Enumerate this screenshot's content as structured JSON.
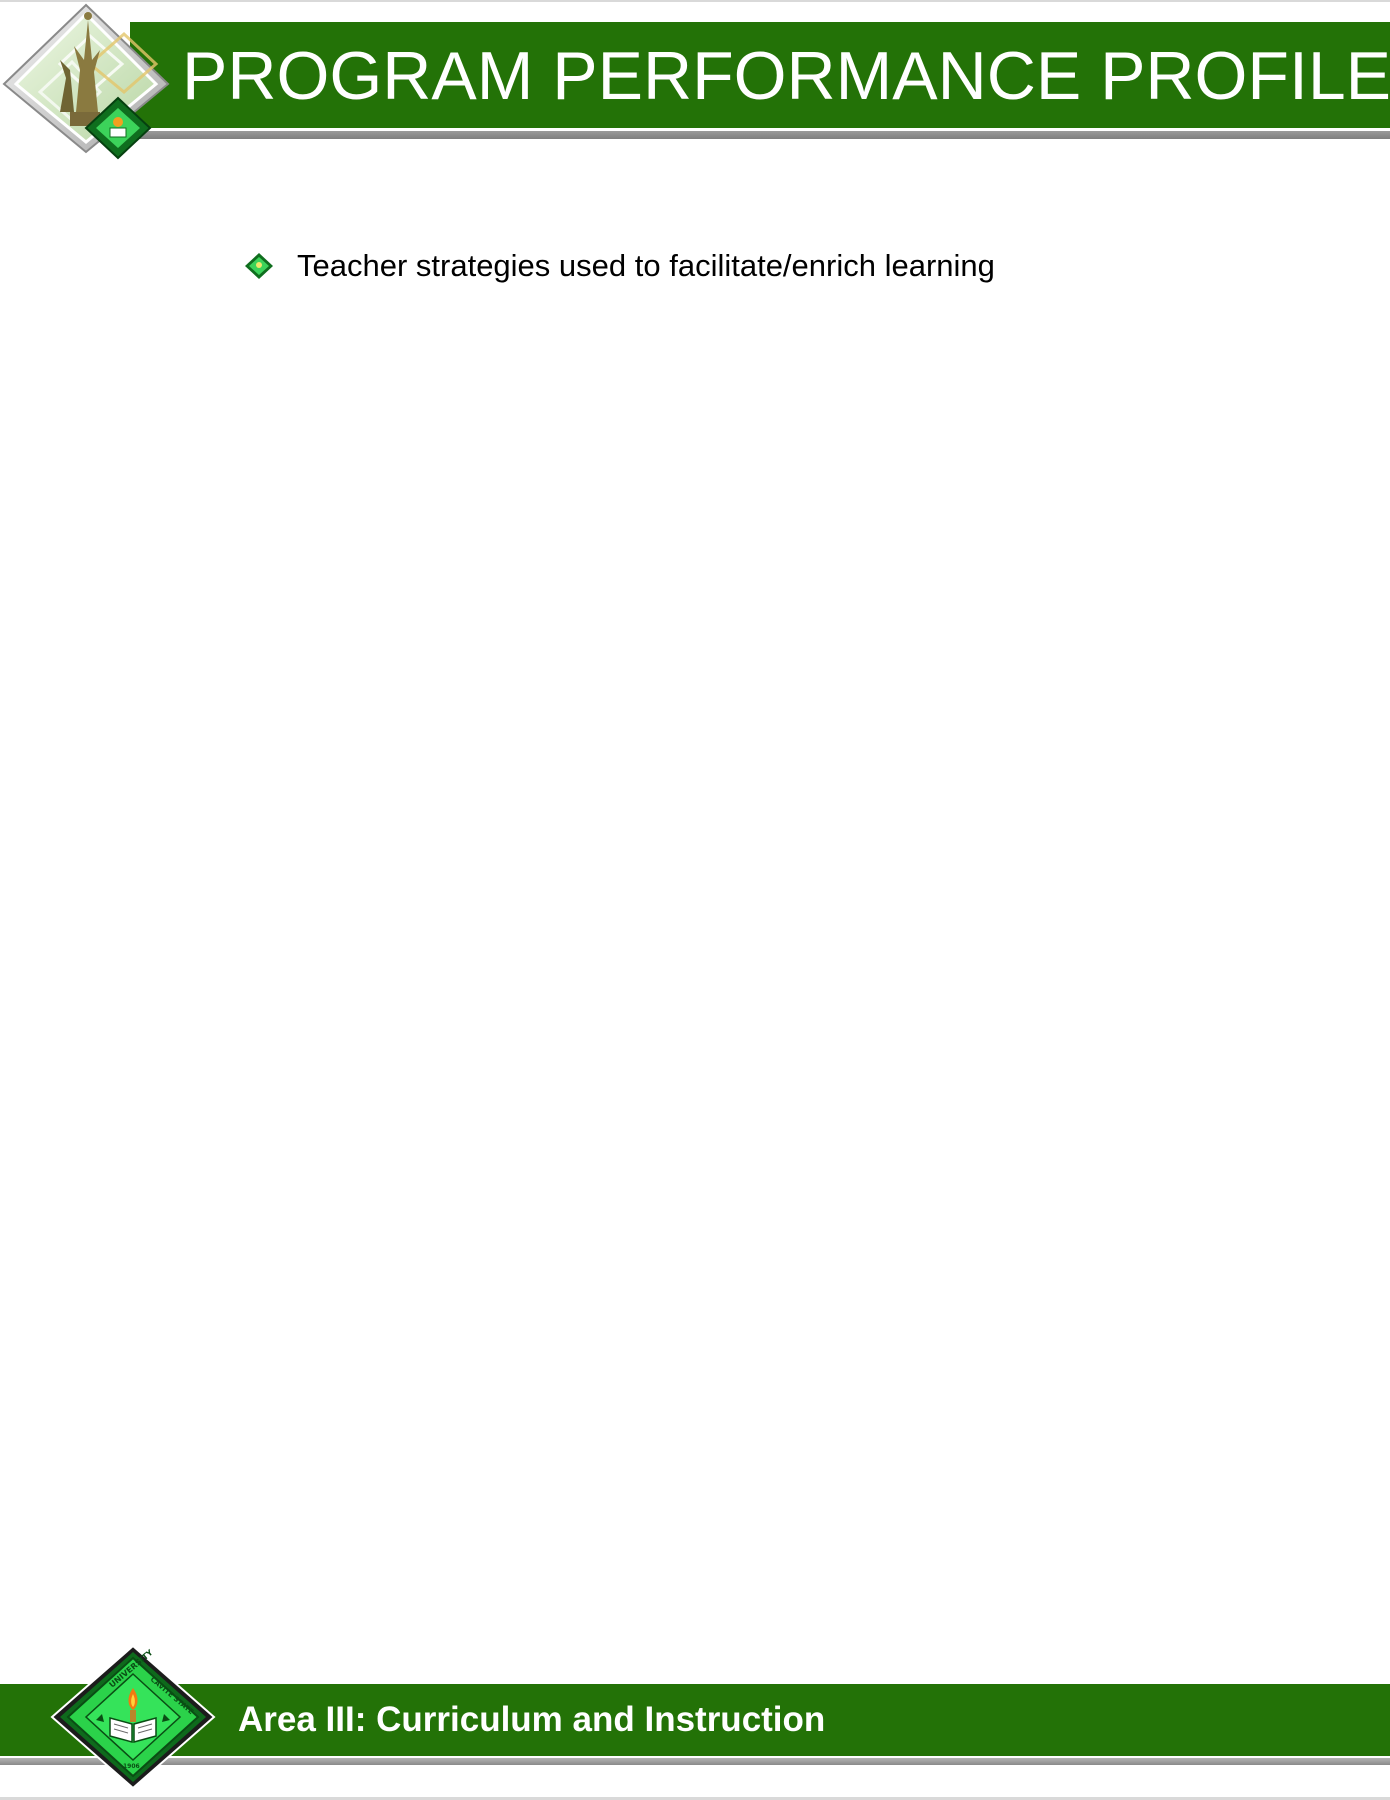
{
  "header": {
    "title": "PROGRAM PERFORMANCE PROFILE",
    "emblem_icon": "university-statue-emblem-icon"
  },
  "content": {
    "bullet_icon": "green-diamond-bullet-icon",
    "items": [
      {
        "text": "Teacher strategies used to facilitate/enrich learning"
      }
    ]
  },
  "footer": {
    "area_title": "Area III: Curriculum and Instruction",
    "seal_icon": "university-seal-icon",
    "seal_text": {
      "top": "UNIVERSITY",
      "right": "CAVITE STATE",
      "bottom": "1906"
    }
  },
  "colors": {
    "band_green": "#237207",
    "seal_green": "#2bd24a",
    "title_text": "#ffffff",
    "body_text": "#000000",
    "rule_grey": "#8c8c8c"
  }
}
